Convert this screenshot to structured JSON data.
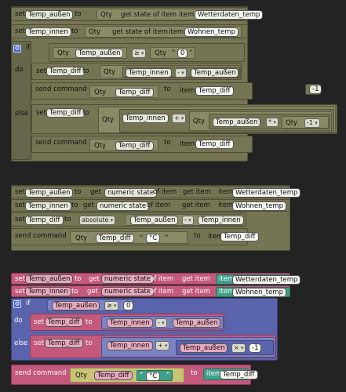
{
  "kw": {
    "set": "set",
    "to": "to",
    "if": "if",
    "do": "do",
    "else": "else",
    "qty": "Qty",
    "send_command": "send command",
    "get_state_of_item": "get state of item",
    "item": "item",
    "get": "get",
    "numeric_state": "numeric state",
    "of_item": "of item",
    "get_item": "get item",
    "absolute": "absolute",
    "op_ge": "≥",
    "op_minus": "-",
    "op_plus": "+",
    "op_mul": "*",
    "op_times": "×",
    "quote_open": "“",
    "quote_close": "”"
  },
  "vars": {
    "temp_aussen": "Temp_außen",
    "temp_innen": "Temp_innen",
    "temp_diff": "Temp_diff"
  },
  "items": {
    "wetterdaten": "Wetterdaten_temp",
    "wohnen": "Wohnen_temp"
  },
  "values": {
    "zero_text": "0",
    "zero_num": "0",
    "minus_one": "-1",
    "unit": "°C"
  },
  "colors": {
    "background": "#232323",
    "olive": "#757553",
    "pink": "#c4597c",
    "blue": "#5a64ad",
    "green": "#3f9f88",
    "yellow": "#c8c474"
  }
}
